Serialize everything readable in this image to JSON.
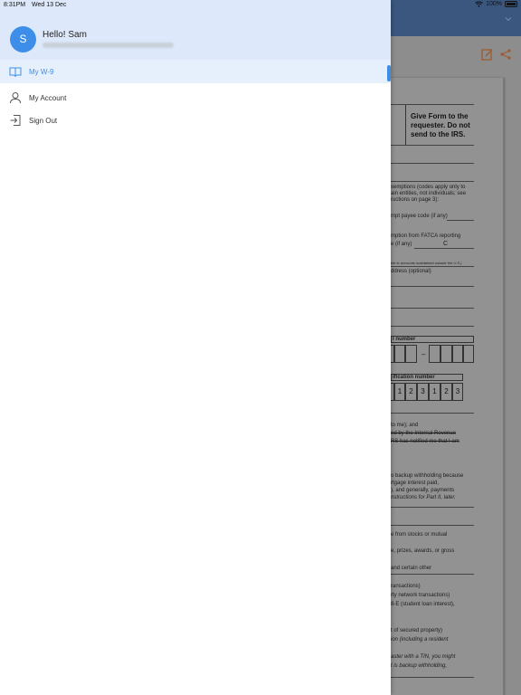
{
  "status_bar": {
    "time": "8:31PM",
    "date": "Wed 13 Dec",
    "battery": "100%"
  },
  "drawer": {
    "avatar_initial": "S",
    "greeting": "Hello! Sam",
    "menu": [
      {
        "label": "My W-9",
        "icon": "book-icon",
        "active": true
      },
      {
        "label": "My Account",
        "icon": "user-icon",
        "active": false
      },
      {
        "label": "Sign Out",
        "icon": "sign-out-icon",
        "active": false
      }
    ]
  },
  "document": {
    "give_form": [
      "Give Form to the",
      "requester. Do not",
      "send to the IRS."
    ],
    "exemptions": [
      "xemptions (codes apply only to",
      "ain entities, not individuals; see",
      "ructions on page 3):"
    ],
    "exempt_payee": "mpt payee code (if any)",
    "fatca": "mption from FATCA reporting",
    "fatca_if_any": "e (if any)",
    "fatca_value": "C",
    "accounts_note": "ble to accounts maintained outside the U.S.)",
    "address_optional": "ddress (optional)",
    "number_label": "l number",
    "ein_label": "ification number",
    "ein_digits": [
      "1",
      "2",
      "3",
      "1",
      "2",
      "3"
    ],
    "cert_lines": [
      "to me); and",
      "ed by the Internal Revenue",
      "RS has notified me that I am"
    ],
    "backup_lines": [
      "o backup withholding because",
      "rtgage interest paid,",
      "), and generally, payments",
      "nstructions for Part II, later."
    ],
    "stocks_line": "e from stocks or mutual",
    "prizes_line": "e, prizes, awards, or gross",
    "other_line": "and certain other",
    "transactions_lines": [
      "ransactions)",
      "rty network transactions)",
      "8-E (student loan interest),"
    ],
    "property_lines": [
      "t of secured property)",
      "ion (including a resident"
    ],
    "tin_lines": [
      "aster with a TIN, you might",
      "t is backup withholding,"
    ]
  }
}
